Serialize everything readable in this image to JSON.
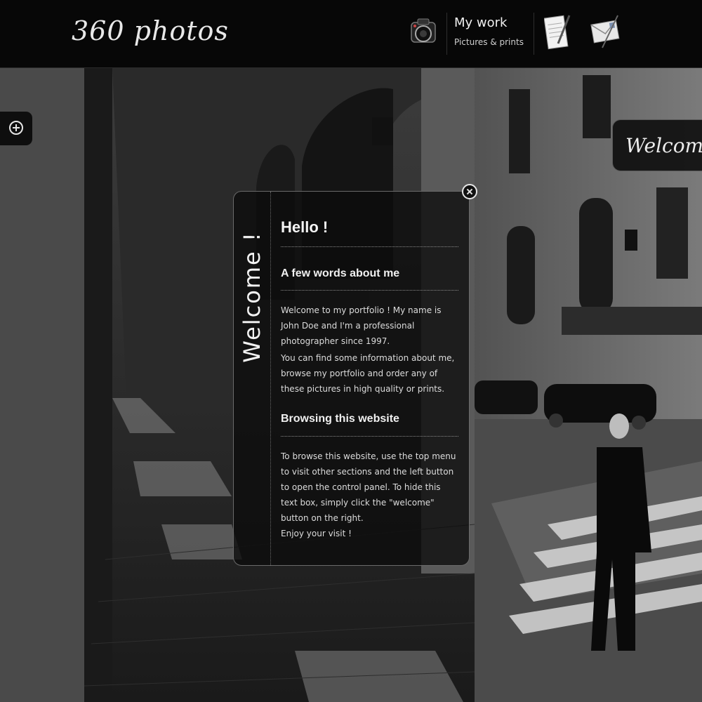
{
  "header": {
    "logo": "360 photos",
    "nav_work_title": "My work",
    "nav_work_subtitle": "Pictures & prints"
  },
  "icons": {
    "panel_toggle": "plus-circle-icon",
    "camera": "camera-icon",
    "notes": "notepad-icon",
    "mail": "mail-icon",
    "close": "close-icon"
  },
  "welcome_tab": {
    "label": "Welcome"
  },
  "dialog": {
    "side_title": "Welcome !",
    "hello": "Hello !",
    "section1_title": "A few words about me",
    "para1": "Welcome to my portfolio ! My name is John Doe and I'm a professional photographer since 1997.",
    "para2": "You can find some information about me, browse my portfolio and order any of these pictures in high quality or prints.",
    "section2_title": "Browsing this website",
    "para3": "To browse this website, use the top menu to visit other sections and the left button to open the control panel. To hide this text box, simply click the \"welcome\" button on the right.",
    "para4": "Enjoy your visit !"
  },
  "colors": {
    "header_bg": "#070707",
    "dialog_bg": "#0c0c0c",
    "text": "#e6e6e6"
  }
}
